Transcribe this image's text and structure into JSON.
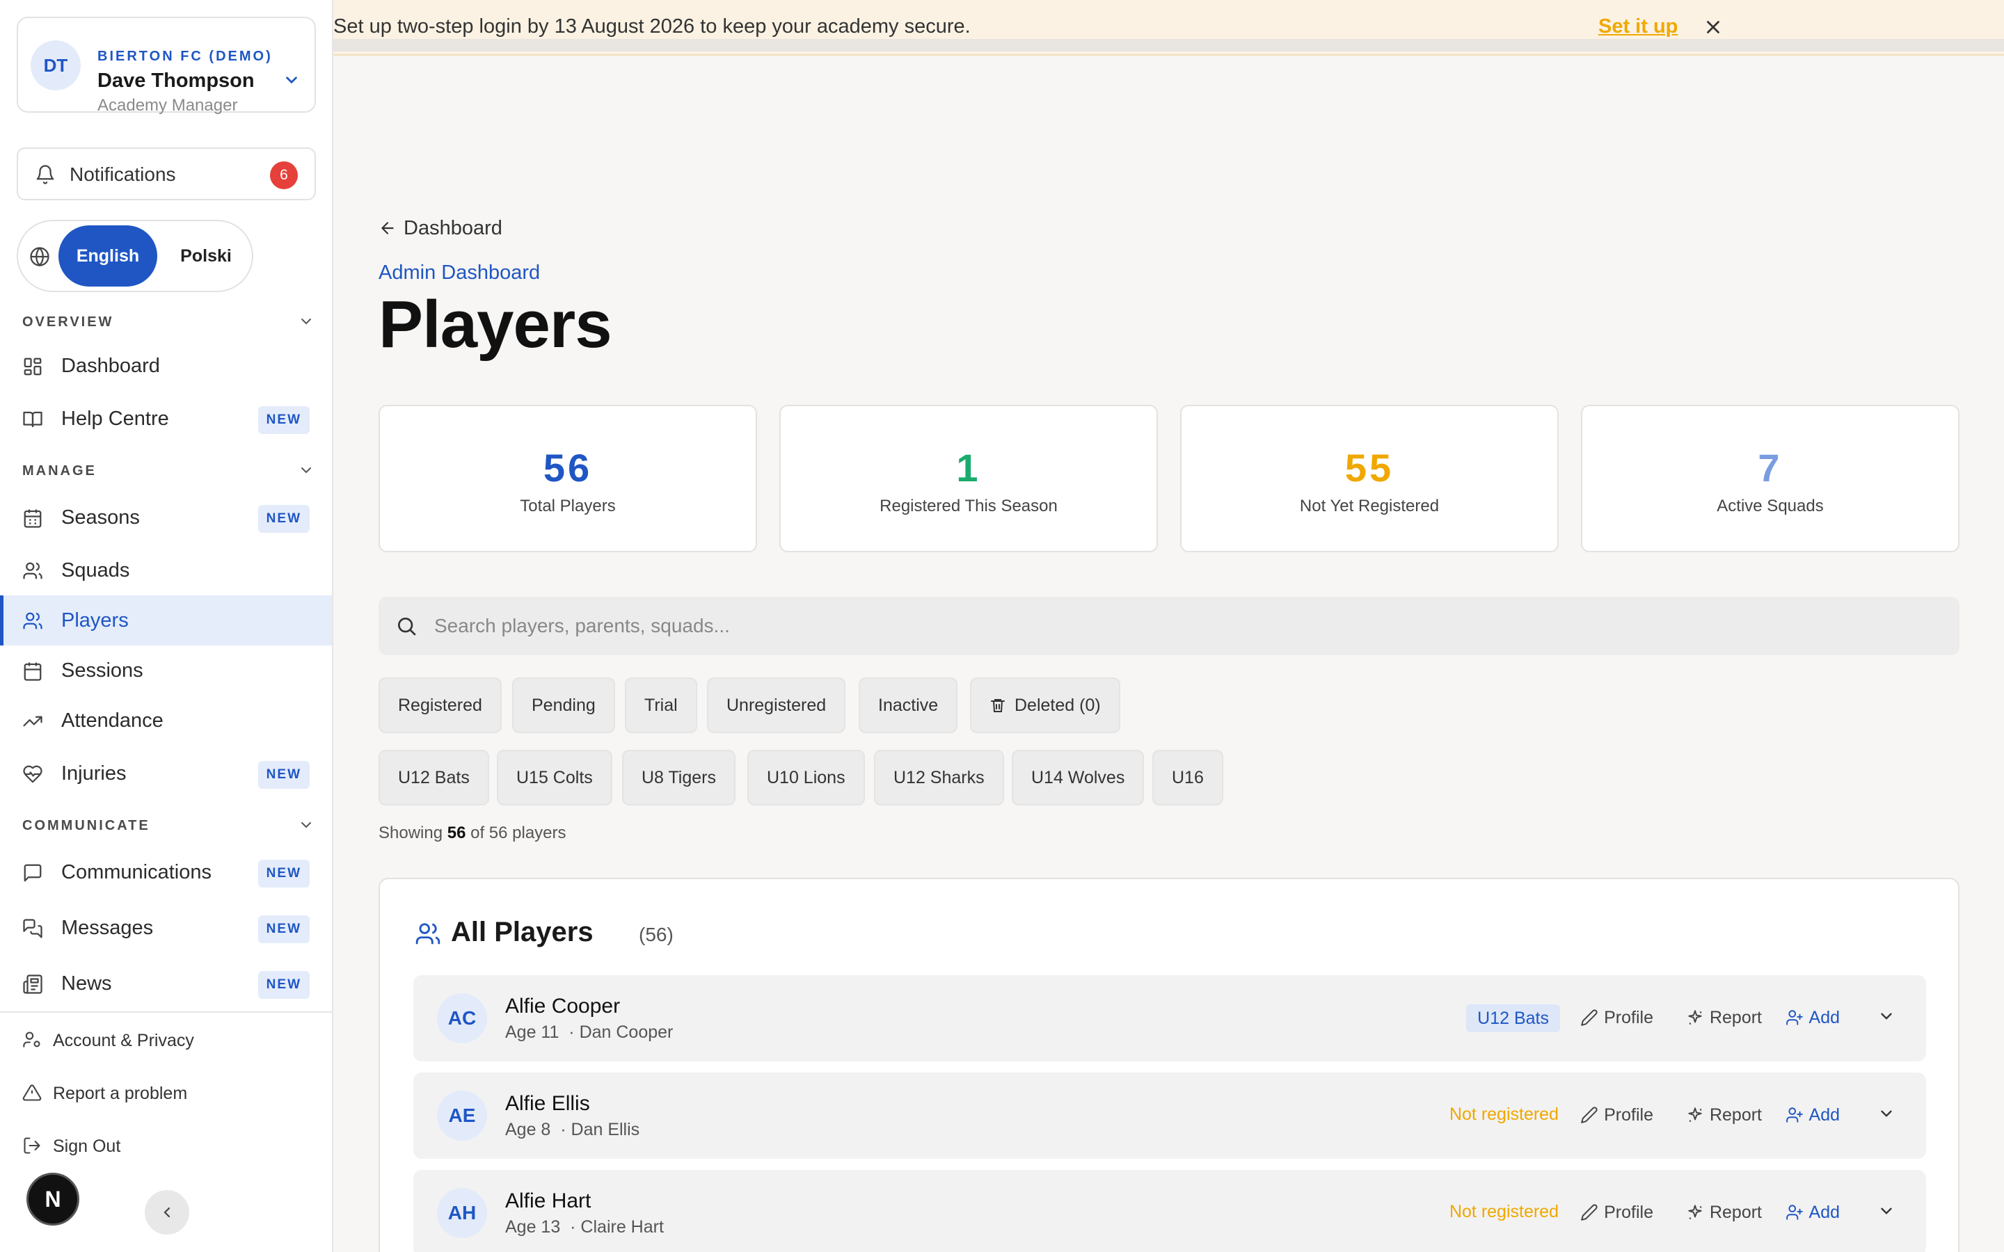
{
  "user": {
    "org": "BIERTON FC (DEMO)",
    "name": "Dave Thompson",
    "role": "Academy Manager",
    "initials": "DT"
  },
  "notifications": {
    "label": "Notifications",
    "count": "6"
  },
  "language": {
    "active": "English",
    "other": "Polski"
  },
  "sidebar": {
    "overview_heading": "OVERVIEW",
    "manage_heading": "MANAGE",
    "communicate_heading": "COMMUNICATE",
    "overview": [
      {
        "label": "Dashboard",
        "icon": "dashboard-icon"
      },
      {
        "label": "Help Centre",
        "badge": "NEW",
        "icon": "book-icon"
      }
    ],
    "manage": [
      {
        "label": "Seasons",
        "badge": "NEW",
        "icon": "calendar-icon"
      },
      {
        "label": "Squads",
        "icon": "users-icon"
      },
      {
        "label": "Players",
        "icon": "players-icon",
        "active": true
      },
      {
        "label": "Sessions",
        "icon": "calendar-icon"
      },
      {
        "label": "Attendance",
        "icon": "trend-icon"
      },
      {
        "label": "Injuries",
        "badge": "NEW",
        "icon": "heart-pulse-icon"
      }
    ],
    "communicate": [
      {
        "label": "Communications",
        "badge": "NEW",
        "icon": "message-square-icon"
      },
      {
        "label": "Messages",
        "badge": "NEW",
        "icon": "messages-icon"
      },
      {
        "label": "News",
        "badge": "NEW",
        "icon": "newspaper-icon"
      }
    ],
    "utility": [
      {
        "label": "Account & Privacy",
        "icon": "user-cog-icon"
      },
      {
        "label": "Report a problem",
        "icon": "alert-triangle-icon"
      },
      {
        "label": "Sign Out",
        "icon": "sign-out-icon"
      }
    ],
    "logo_letter": "N"
  },
  "banner": {
    "message": "Set up two-step login by 13 August 2026 to keep your academy secure.",
    "cta": "Set it up"
  },
  "breadcrumb": {
    "back": "Dashboard",
    "parent": "Admin Dashboard"
  },
  "page_title": "Players",
  "stats": [
    {
      "value": "56",
      "label": "Total Players",
      "color": "#1f56c4"
    },
    {
      "value": "1",
      "label": "Registered This Season",
      "color": "#1aab6d"
    },
    {
      "value": "55",
      "label": "Not Yet Registered",
      "color": "#f0a800"
    },
    {
      "value": "7",
      "label": "Active Squads",
      "color": "#7a9ce0"
    }
  ],
  "search": {
    "placeholder": "Search players, parents, squads..."
  },
  "status_filters": [
    "Registered",
    "Pending",
    "Trial",
    "Unregistered",
    "Inactive",
    "Deleted (0)"
  ],
  "squad_filters": [
    "U12 Bats",
    "U15 Colts",
    "U8 Tigers",
    "U10 Lions",
    "U12 Sharks",
    "U14 Wolves",
    "U16"
  ],
  "showing": {
    "prefix": "Showing",
    "count": "56",
    "suffix": "of 56 players"
  },
  "players_panel": {
    "title": "All Players",
    "count": "(56)"
  },
  "actions": {
    "profile": "Profile",
    "report": "Report",
    "add": "Add"
  },
  "players": [
    {
      "initials": "AC",
      "name": "Alfie Cooper",
      "age": "Age 11",
      "parent": "· Dan Cooper",
      "squad": "U12 Bats",
      "status": ""
    },
    {
      "initials": "AE",
      "name": "Alfie Ellis",
      "age": "Age 8",
      "parent": "· Dan Ellis",
      "squad": "",
      "status": "Not registered"
    },
    {
      "initials": "AH",
      "name": "Alfie Hart",
      "age": "Age 13",
      "parent": "· Claire Hart",
      "squad": "",
      "status": "Not registered"
    }
  ]
}
